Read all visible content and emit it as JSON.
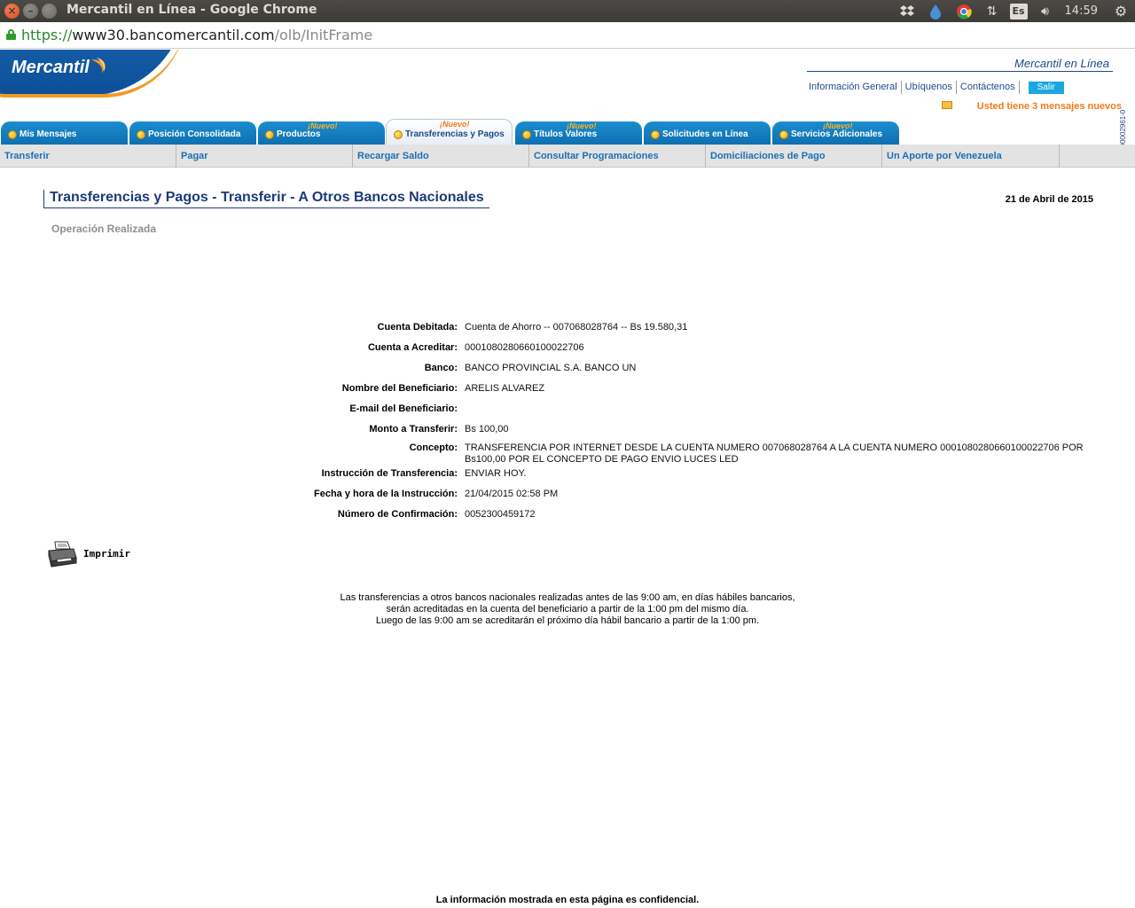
{
  "window": {
    "title": "Mercantil en Línea - Google Chrome",
    "tray": {
      "keyboard_layout": "Es",
      "clock": "14:59"
    }
  },
  "url": {
    "scheme": "https://",
    "host": "www30.bancomercantil.com",
    "path": "/olb/InitFrame"
  },
  "header": {
    "logo_text": "Mercantil",
    "brand_name": "Mercantil en Línea",
    "links": [
      "Información General",
      "Ubíquenos",
      "Contáctenos"
    ],
    "salir_label": "Salir",
    "messages_notice": "Usted tiene 3 mensajes nuevos",
    "side_code": "J-00002961-0"
  },
  "tabs": [
    {
      "label": "Mis Mensajes",
      "new_badge": "",
      "active": false
    },
    {
      "label": "Posición Consolidada",
      "new_badge": "",
      "active": false
    },
    {
      "label": "Productos",
      "new_badge": "¡Nuevo!",
      "active": false
    },
    {
      "label": "Transferencias y Pagos",
      "new_badge": "¡Nuevo!",
      "active": true
    },
    {
      "label": "Títulos Valores",
      "new_badge": "¡Nuevo!",
      "active": false
    },
    {
      "label": "Solicitudes en Línea",
      "new_badge": "",
      "active": false
    },
    {
      "label": "Servicios Adicionales",
      "new_badge": "¡Nuevo!",
      "active": false
    }
  ],
  "subnav": [
    "Transferir",
    "Pagar",
    "Recargar Saldo",
    "Consultar Programaciones",
    "Domiciliaciones de Pago",
    "Un Aporte por Venezuela"
  ],
  "page": {
    "title": "Transferencias y Pagos - Transferir - A Otros Bancos Nacionales",
    "date": "21 de Abril de 2015",
    "status": "Operación Realizada"
  },
  "details": [
    {
      "label": "Cuenta Debitada:",
      "value": "Cuenta de Ahorro -- 007068028764 -- Bs 19.580,31"
    },
    {
      "label": "Cuenta a Acreditar:",
      "value": "00010802806601000227​06"
    },
    {
      "label": "Banco:",
      "value": "BANCO PROVINCIAL S.A. BANCO UN"
    },
    {
      "label": "Nombre del Beneficiario:",
      "value": "ARELIS ALVAREZ"
    },
    {
      "label": "E-mail del Beneficiario:",
      "value": ""
    },
    {
      "label": "Monto a Transferir:",
      "value": "Bs 100,00"
    },
    {
      "label": "Concepto:",
      "value": "TRANSFERENCIA POR INTERNET DESDE LA CUENTA NUMERO 007068028764 A LA CUENTA NUMERO 00010802806601000227​06 POR Bs100,00 POR EL CONCEPTO DE PAGO ENVIO LUCES LED"
    },
    {
      "label": "Instrucción de Transferencia:",
      "value": "ENVIAR HOY."
    },
    {
      "label": "Fecha y hora de la Instrucción:",
      "value": "21/04/2015 02:58 PM"
    },
    {
      "label": "Número de Confirmación:",
      "value": "0052300459172"
    }
  ],
  "print_label": "Imprimir",
  "notice_lines": [
    "Las transferencias a otros bancos nacionales realizadas antes de las 9:00 am, en días hábiles bancarios,",
    "serán acreditadas en la cuenta del beneficiario a partir de la 1:00 pm del mismo día.",
    "Luego de las 9:00 am se acreditarán el próximo día hábil bancario a partir de la 1:00 pm."
  ],
  "footer": "La información mostrada en esta página es confidencial.",
  "colors": {
    "brand_blue": "#1c4a8c",
    "tab_blue": "#1a8ed0",
    "accent_orange": "#f07a1a",
    "subnav_link": "#1c6fb4"
  }
}
